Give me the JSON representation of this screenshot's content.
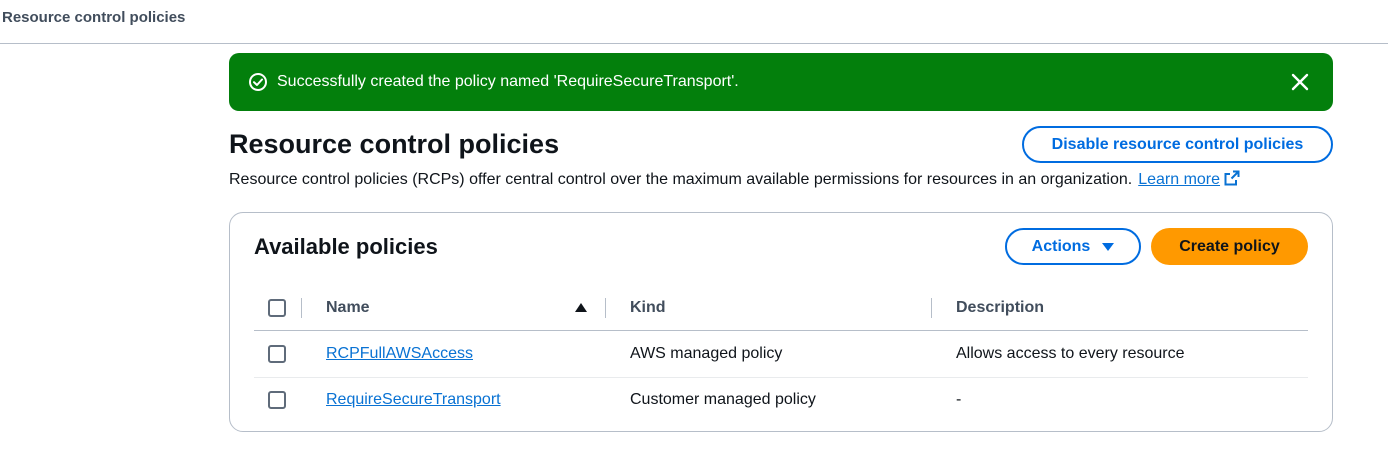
{
  "breadcrumb": {
    "current": "Resource control policies"
  },
  "flash": {
    "message": "Successfully created the policy named 'RequireSecureTransport'.",
    "status": "success",
    "color": "#037f0c"
  },
  "header": {
    "title": "Resource control policies",
    "description": "Resource control policies (RCPs) offer central control over the maximum available permissions for resources in an organization.",
    "learn_more": "Learn more",
    "disable_button": "Disable resource control policies"
  },
  "policies_panel": {
    "title": "Available policies",
    "actions_button": "Actions",
    "create_button": "Create policy",
    "columns": [
      "Name",
      "Kind",
      "Description"
    ],
    "sort": {
      "column": "Name",
      "direction": "ascending"
    },
    "rows": [
      {
        "name": "RCPFullAWSAccess",
        "kind": "AWS managed policy",
        "description": "Allows access to every resource",
        "selected": false
      },
      {
        "name": "RequireSecureTransport",
        "kind": "Customer managed policy",
        "description": "-",
        "selected": false
      }
    ]
  },
  "colors": {
    "primary": "#006ce0",
    "link": "#0972d3",
    "accent": "#ff9900",
    "success": "#037f0c"
  }
}
